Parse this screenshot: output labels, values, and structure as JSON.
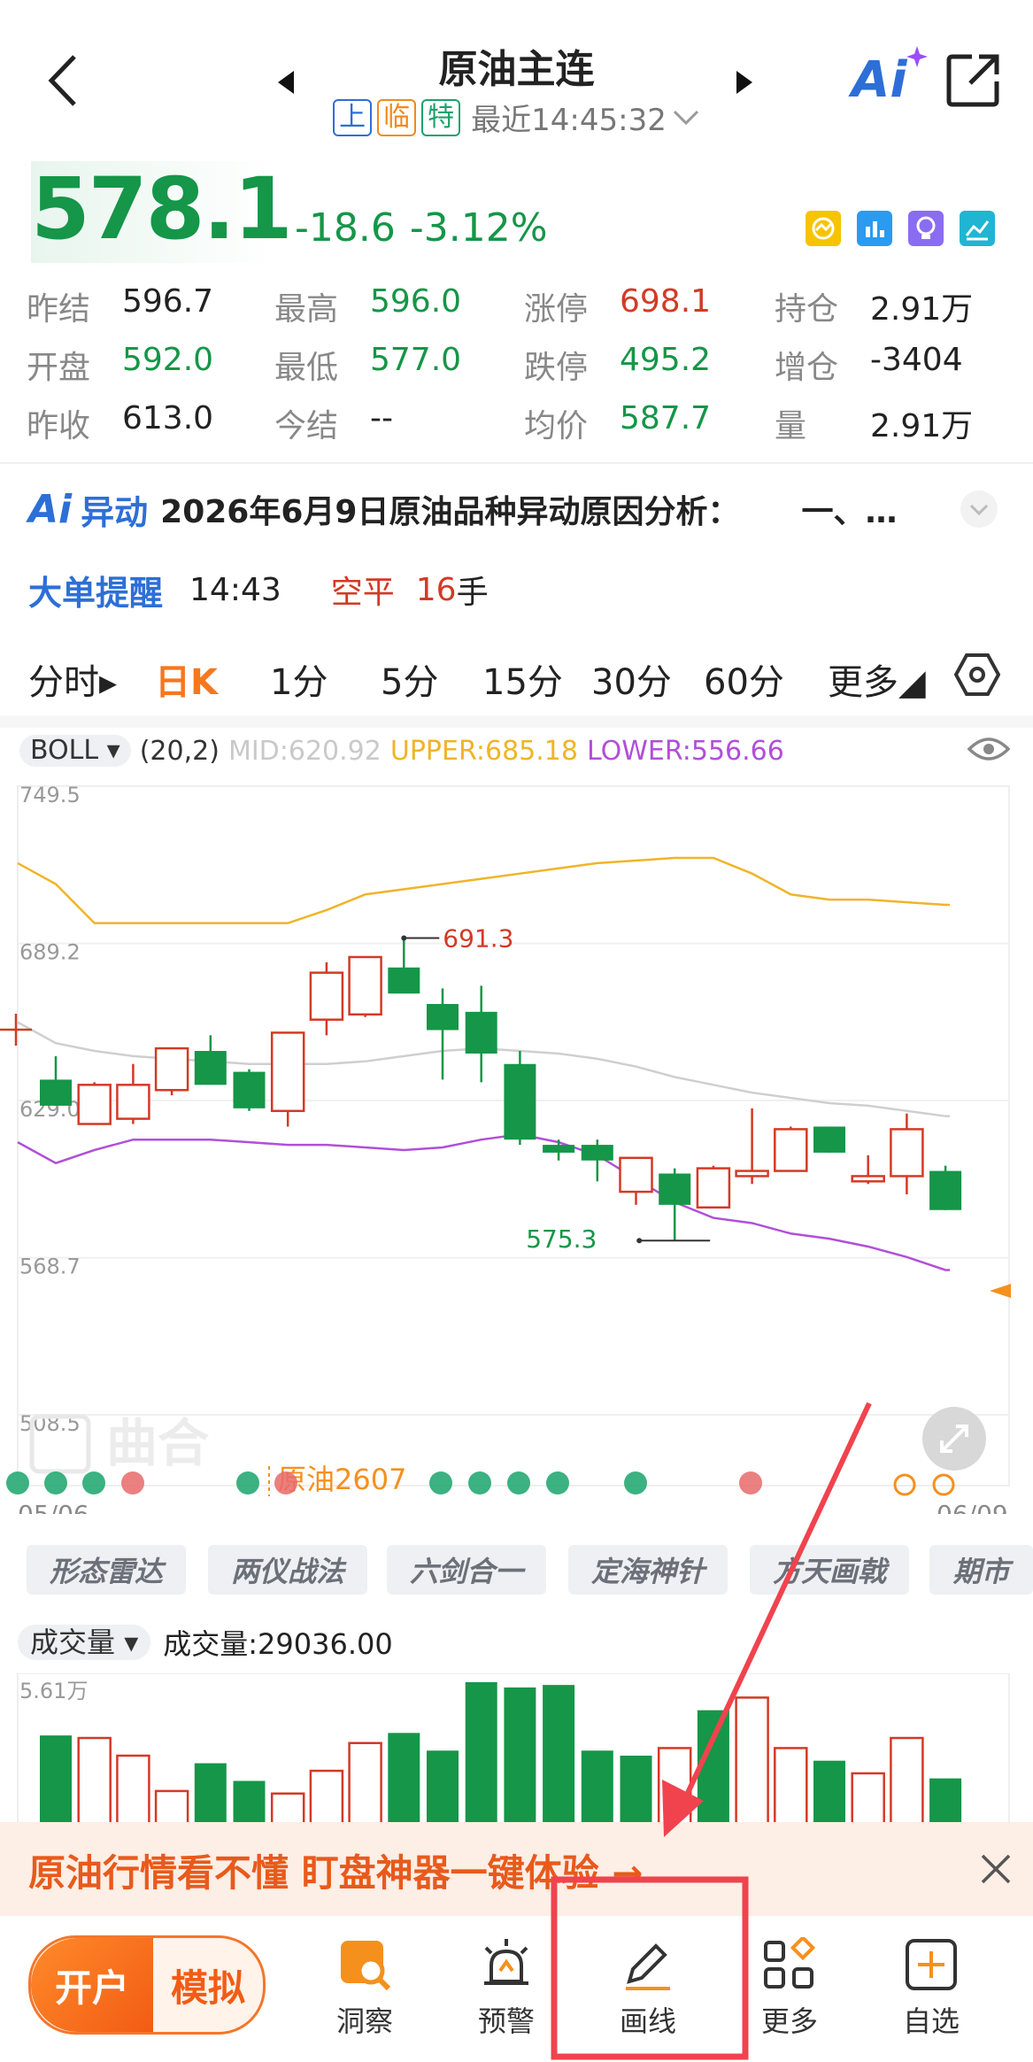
{
  "header": {
    "title": "原油主连",
    "tags": [
      "上",
      "临",
      "特"
    ],
    "tag_colors": [
      "#2d6fd6",
      "#f08a1c",
      "#1aa36c"
    ],
    "time": "最近14:45:32",
    "ai_label": "Ai"
  },
  "quote": {
    "price": "578.1",
    "change": "-18.6",
    "change_pct": "-3.12%",
    "stats": [
      {
        "label": "昨结",
        "value": "596.7",
        "color": "#222222"
      },
      {
        "label": "最高",
        "value": "596.0",
        "color": "#159648"
      },
      {
        "label": "涨停",
        "value": "698.1",
        "color": "#d33a25"
      },
      {
        "label": "持仓",
        "value": "2.91万",
        "color": "#222222"
      },
      {
        "label": "开盘",
        "value": "592.0",
        "color": "#159648"
      },
      {
        "label": "最低",
        "value": "577.0",
        "color": "#159648"
      },
      {
        "label": "跌停",
        "value": "495.2",
        "color": "#159648"
      },
      {
        "label": "增仓",
        "value": "-3404",
        "color": "#222222"
      },
      {
        "label": "昨收",
        "value": "613.0",
        "color": "#222222"
      },
      {
        "label": "今结",
        "value": "--",
        "color": "#222222"
      },
      {
        "label": "均价",
        "value": "587.7",
        "color": "#159648"
      },
      {
        "label": "量",
        "value": "2.91万",
        "color": "#222222"
      }
    ]
  },
  "news": {
    "ai_label": "Ai",
    "tag": "异动",
    "text": "2026年6月9日原油品种异动原因分析：",
    "suffix": "一、…"
  },
  "alert": {
    "title": "大单提醒",
    "time": "14:43",
    "action": "空平",
    "qty": "16",
    "unit": "手"
  },
  "tabs": [
    {
      "label": "分时▸",
      "active": false
    },
    {
      "label": "日K",
      "active": true
    },
    {
      "label": "1分",
      "active": false
    },
    {
      "label": "5分",
      "active": false
    },
    {
      "label": "15分",
      "active": false
    },
    {
      "label": "30分",
      "active": false
    },
    {
      "label": "60分",
      "active": false
    },
    {
      "label": "更多◢",
      "active": false
    }
  ],
  "indicator": {
    "name": "BOLL",
    "params": "(20,2)",
    "mid": "MID:620.92",
    "upper": "UPPER:685.18",
    "lower": "LOWER:556.66"
  },
  "chart_data": {
    "type": "candlestick",
    "y_ticks": [
      "749.5",
      "689.2",
      "629.0",
      "568.7",
      "508.5"
    ],
    "ylim": [
      508.5,
      749.5
    ],
    "x_start": "05/06",
    "x_end": "06/09",
    "label_high": "691.3",
    "label_low": "575.3",
    "watermark": "曲合",
    "contract_label": "原油2607",
    "up_color": "#d33a25",
    "down_color": "#159648",
    "candles": [
      {
        "o": 637,
        "h": 646,
        "l": 627,
        "c": 627
      },
      {
        "o": 620,
        "h": 636,
        "l": 620,
        "c": 635
      },
      {
        "o": 622,
        "h": 643,
        "l": 620,
        "c": 635
      },
      {
        "o": 633,
        "h": 649,
        "l": 631,
        "c": 649
      },
      {
        "o": 648,
        "h": 654,
        "l": 636,
        "c": 635
      },
      {
        "o": 640,
        "h": 641,
        "l": 625,
        "c": 626
      },
      {
        "o": 625,
        "h": 655,
        "l": 619,
        "c": 655
      },
      {
        "o": 660,
        "h": 682,
        "l": 654,
        "c": 678
      },
      {
        "o": 662,
        "h": 681,
        "l": 661,
        "c": 684
      },
      {
        "o": 680,
        "h": 691.3,
        "l": 673,
        "c": 670
      },
      {
        "o": 666,
        "h": 672,
        "l": 637,
        "c": 656
      },
      {
        "o": 663,
        "h": 673,
        "l": 636,
        "c": 647
      },
      {
        "o": 643,
        "h": 648,
        "l": 612,
        "c": 614
      },
      {
        "o": 612,
        "h": 614,
        "l": 606,
        "c": 609
      },
      {
        "o": 612,
        "h": 614,
        "l": 598,
        "c": 606
      },
      {
        "o": 594,
        "h": 607,
        "l": 589,
        "c": 607
      },
      {
        "o": 601,
        "h": 603,
        "l": 575.3,
        "c": 589
      },
      {
        "o": 588,
        "h": 604,
        "l": 588,
        "c": 603
      },
      {
        "o": 600,
        "h": 626,
        "l": 597,
        "c": 602
      },
      {
        "o": 602,
        "h": 619,
        "l": 602,
        "c": 618
      },
      {
        "o": 619,
        "h": 619,
        "l": 609,
        "c": 609
      },
      {
        "o": 598,
        "h": 608,
        "l": 597,
        "c": 600
      },
      {
        "o": 600,
        "h": 624,
        "l": 593,
        "c": 618
      },
      {
        "o": 602,
        "h": 604,
        "l": 587,
        "c": 587
      }
    ],
    "boll_upper": [
      712,
      697,
      697,
      697,
      697,
      697,
      697,
      702,
      708,
      710,
      712,
      714,
      716,
      718,
      720,
      721,
      722,
      722,
      716,
      708,
      706,
      706,
      705,
      704
    ],
    "boll_mid": [
      651,
      648,
      646,
      645,
      644,
      643,
      643,
      643,
      644,
      646,
      648,
      649,
      648,
      647,
      645,
      642,
      638,
      635,
      632,
      630,
      628,
      627,
      625,
      623
    ],
    "boll_lower": [
      605,
      610,
      614,
      614,
      614,
      613,
      612,
      612,
      611,
      610,
      611,
      614,
      616,
      613,
      608,
      599,
      590,
      584,
      582,
      578,
      576,
      573,
      569,
      564
    ]
  },
  "volume": {
    "label": "成交量",
    "text": "成交量:29036.00",
    "max_label": "5.61万",
    "values": [
      3.5,
      3.4,
      2.7,
      1.3,
      2.4,
      1.7,
      1.2,
      2.1,
      3.2,
      3.6,
      2.9,
      5.61,
      5.4,
      5.5,
      2.9,
      2.7,
      3.0,
      4.5,
      5.0,
      3.0,
      2.5,
      2.0,
      3.4,
      1.8
    ],
    "up": [
      false,
      true,
      true,
      true,
      false,
      false,
      true,
      true,
      true,
      false,
      false,
      false,
      false,
      false,
      false,
      false,
      true,
      false,
      true,
      true,
      false,
      true,
      true,
      false
    ]
  },
  "strategies": [
    "形态雷达",
    "两仪战法",
    "六剑合一",
    "定海神针",
    "方天画戟",
    "期市"
  ],
  "banner": {
    "text": "原油行情看不懂  盯盘神器一键体验 →"
  },
  "bottom_nav": {
    "open_account": "开户",
    "simulate": "模拟",
    "items": [
      {
        "label": "洞察",
        "icon": "insight-icon"
      },
      {
        "label": "预警",
        "icon": "alarm-icon"
      },
      {
        "label": "画线",
        "icon": "pencil-icon"
      },
      {
        "label": "更多",
        "icon": "grid-icon"
      },
      {
        "label": "自选",
        "icon": "add-watchlist-icon"
      }
    ]
  }
}
